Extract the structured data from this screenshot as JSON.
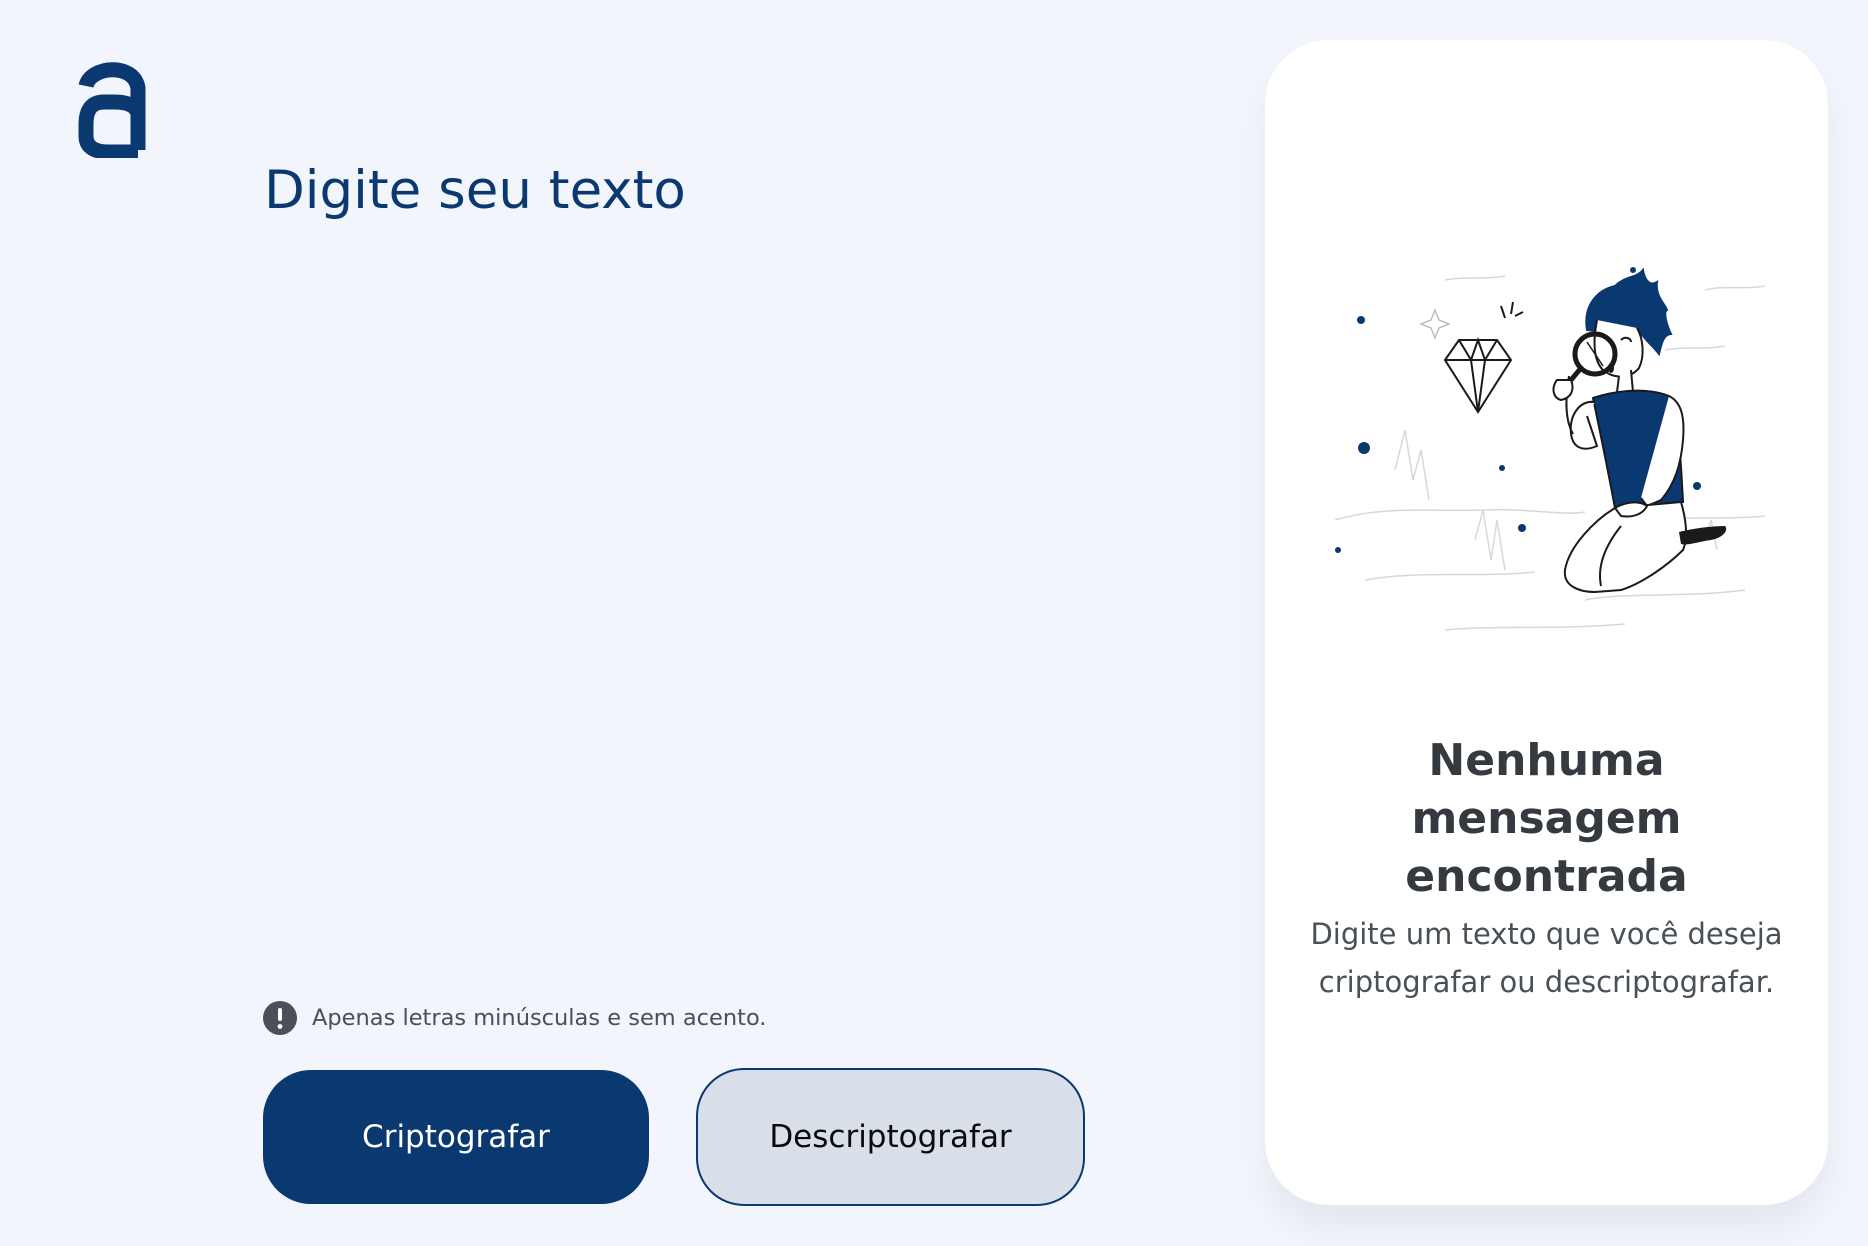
{
  "colors": {
    "background": "#f3f5fc",
    "primary": "#0a3871",
    "secondary_button_bg": "#d8dfe8",
    "panel_bg": "#ffffff",
    "heading_text": "#343a40",
    "body_text": "#495057"
  },
  "header": {
    "logo_icon": "alura-a-logo-icon"
  },
  "input": {
    "placeholder": "Digite seu texto",
    "value": ""
  },
  "warning": {
    "icon": "exclamation-circle-icon",
    "text": "Apenas letras minúsculas e sem acento."
  },
  "buttons": {
    "encrypt_label": "Criptografar",
    "decrypt_label": "Descriptografar"
  },
  "output_panel": {
    "illustration": "person-with-magnifying-glass-illustration",
    "title": "Nenhuma mensagem encontrada",
    "description": "Digite um texto que você deseja criptografar ou descriptografar."
  }
}
